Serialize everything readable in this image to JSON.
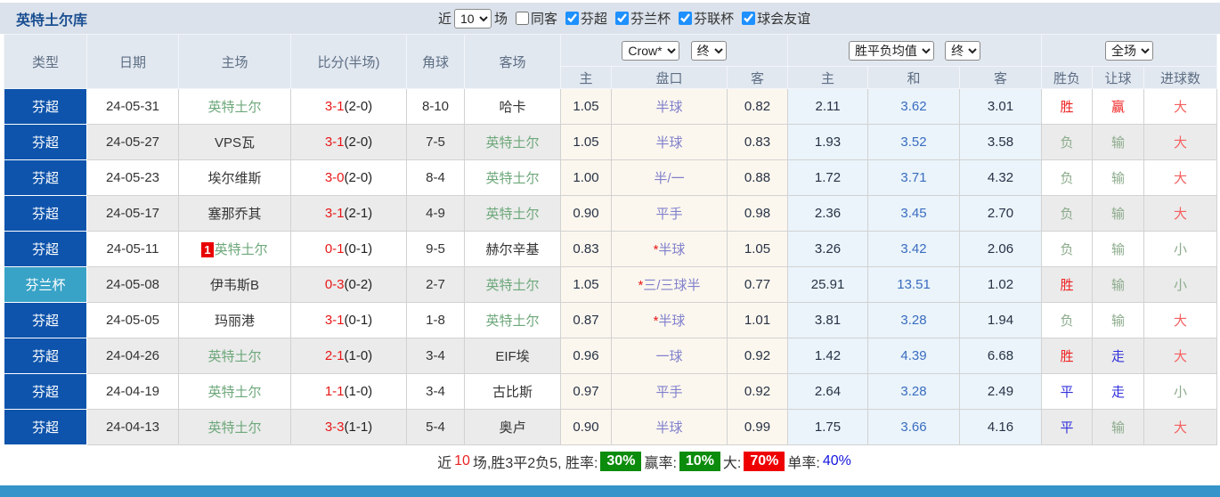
{
  "topbar": {
    "title": "英特土尔库",
    "recent_label": "近",
    "recent_value": "10",
    "matches_label": "场",
    "same_venue": {
      "label": "同客",
      "checked": false
    },
    "filters": [
      {
        "label": "芬超",
        "checked": true
      },
      {
        "label": "芬兰杯",
        "checked": true
      },
      {
        "label": "芬联杯",
        "checked": true
      },
      {
        "label": "球会友谊",
        "checked": true
      }
    ]
  },
  "table_header": {
    "cols": [
      "类型",
      "日期",
      "主场",
      "比分(半场)",
      "角球",
      "客场"
    ],
    "bookmaker": "Crow*",
    "odds_time": "终",
    "avg_name": "胜平负均值",
    "avg_time": "终",
    "scope": "全场",
    "sub": [
      "主",
      "盘口",
      "客",
      "主",
      "和",
      "客",
      "胜负",
      "让球",
      "进球数"
    ]
  },
  "rows": [
    {
      "league": "芬超",
      "lcls": "lg-super",
      "date": "24-05-31",
      "badge": "",
      "home": "英特土尔",
      "hcls": "self",
      "score": "3-1",
      "half": "(2-0)",
      "corner": "8-10",
      "away": "哈卡",
      "acls": "",
      "odds_home": "1.05",
      "star": "",
      "handicap": "半球",
      "odds_away": "0.82",
      "avg_home": "2.11",
      "avg_draw": "3.62",
      "avg_away": "3.01",
      "result": "胜",
      "result_cls": "c-red",
      "hr": "赢",
      "hr_cls": "c-red",
      "goals": "大",
      "goals_cls": "c-red2"
    },
    {
      "league": "芬超",
      "lcls": "lg-super",
      "date": "24-05-27",
      "badge": "",
      "home": "VPS瓦",
      "hcls": "",
      "score": "3-1",
      "half": "(2-0)",
      "corner": "7-5",
      "away": "英特土尔",
      "acls": "self",
      "odds_home": "1.05",
      "star": "",
      "handicap": "半球",
      "odds_away": "0.83",
      "avg_home": "1.93",
      "avg_draw": "3.52",
      "avg_away": "3.58",
      "result": "负",
      "result_cls": "c-green",
      "hr": "输",
      "hr_cls": "c-green",
      "goals": "大",
      "goals_cls": "c-red2"
    },
    {
      "league": "芬超",
      "lcls": "lg-super",
      "date": "24-05-23",
      "badge": "",
      "home": "埃尔维斯",
      "hcls": "",
      "score": "3-0",
      "half": "(2-0)",
      "corner": "8-4",
      "away": "英特土尔",
      "acls": "self",
      "odds_home": "1.00",
      "star": "",
      "handicap": "半/一",
      "odds_away": "0.88",
      "avg_home": "1.72",
      "avg_draw": "3.71",
      "avg_away": "4.32",
      "result": "负",
      "result_cls": "c-green",
      "hr": "输",
      "hr_cls": "c-green",
      "goals": "大",
      "goals_cls": "c-red2"
    },
    {
      "league": "芬超",
      "lcls": "lg-super",
      "date": "24-05-17",
      "badge": "",
      "home": "塞那乔其",
      "hcls": "",
      "score": "3-1",
      "half": "(2-1)",
      "corner": "4-9",
      "away": "英特土尔",
      "acls": "self",
      "odds_home": "0.90",
      "star": "",
      "handicap": "平手",
      "odds_away": "0.98",
      "avg_home": "2.36",
      "avg_draw": "3.45",
      "avg_away": "2.70",
      "result": "负",
      "result_cls": "c-green",
      "hr": "输",
      "hr_cls": "c-green",
      "goals": "大",
      "goals_cls": "c-red2"
    },
    {
      "league": "芬超",
      "lcls": "lg-super",
      "date": "24-05-11",
      "badge": "1",
      "home": "英特土尔",
      "hcls": "self",
      "score": "0-1",
      "half": "(0-1)",
      "corner": "9-5",
      "away": "赫尔辛基",
      "acls": "",
      "odds_home": "0.83",
      "star": "*",
      "handicap": "半球",
      "odds_away": "1.05",
      "avg_home": "3.26",
      "avg_draw": "3.42",
      "avg_away": "2.06",
      "result": "负",
      "result_cls": "c-green",
      "hr": "输",
      "hr_cls": "c-green",
      "goals": "小",
      "goals_cls": "c-green"
    },
    {
      "league": "芬兰杯",
      "lcls": "lg-cup",
      "date": "24-05-08",
      "badge": "",
      "home": "伊韦斯B",
      "hcls": "",
      "score": "0-3",
      "half": "(0-2)",
      "corner": "2-7",
      "away": "英特土尔",
      "acls": "self",
      "odds_home": "1.05",
      "star": "*",
      "handicap": "三/三球半",
      "odds_away": "0.77",
      "avg_home": "25.91",
      "avg_draw": "13.51",
      "avg_away": "1.02",
      "result": "胜",
      "result_cls": "c-red",
      "hr": "输",
      "hr_cls": "c-green",
      "goals": "小",
      "goals_cls": "c-green"
    },
    {
      "league": "芬超",
      "lcls": "lg-super",
      "date": "24-05-05",
      "badge": "",
      "home": "玛丽港",
      "hcls": "",
      "score": "3-1",
      "half": "(0-1)",
      "corner": "1-8",
      "away": "英特土尔",
      "acls": "self",
      "odds_home": "0.87",
      "star": "*",
      "handicap": "半球",
      "odds_away": "1.01",
      "avg_home": "3.81",
      "avg_draw": "3.28",
      "avg_away": "1.94",
      "result": "负",
      "result_cls": "c-green",
      "hr": "输",
      "hr_cls": "c-green",
      "goals": "大",
      "goals_cls": "c-red2"
    },
    {
      "league": "芬超",
      "lcls": "lg-super",
      "date": "24-04-26",
      "badge": "",
      "home": "英特土尔",
      "hcls": "self",
      "score": "2-1",
      "half": "(1-0)",
      "corner": "3-4",
      "away": "EIF埃",
      "acls": "",
      "odds_home": "0.96",
      "star": "",
      "handicap": "一球",
      "odds_away": "0.92",
      "avg_home": "1.42",
      "avg_draw": "4.39",
      "avg_away": "6.68",
      "result": "胜",
      "result_cls": "c-red",
      "hr": "走",
      "hr_cls": "c-blue",
      "goals": "大",
      "goals_cls": "c-red2"
    },
    {
      "league": "芬超",
      "lcls": "lg-super",
      "date": "24-04-19",
      "badge": "",
      "home": "英特土尔",
      "hcls": "self",
      "score": "1-1",
      "half": "(1-0)",
      "corner": "3-4",
      "away": "古比斯",
      "acls": "",
      "odds_home": "0.97",
      "star": "",
      "handicap": "平手",
      "odds_away": "0.92",
      "avg_home": "2.64",
      "avg_draw": "3.28",
      "avg_away": "2.49",
      "result": "平",
      "result_cls": "c-blue",
      "hr": "走",
      "hr_cls": "c-blue",
      "goals": "小",
      "goals_cls": "c-green"
    },
    {
      "league": "芬超",
      "lcls": "lg-super",
      "date": "24-04-13",
      "badge": "",
      "home": "英特土尔",
      "hcls": "self",
      "score": "3-3",
      "half": "(1-1)",
      "corner": "5-4",
      "away": "奥卢",
      "acls": "",
      "odds_home": "0.90",
      "star": "",
      "handicap": "半球",
      "odds_away": "0.99",
      "avg_home": "1.75",
      "avg_draw": "3.66",
      "avg_away": "4.16",
      "result": "平",
      "result_cls": "c-blue",
      "hr": "输",
      "hr_cls": "c-green",
      "goals": "大",
      "goals_cls": "c-red2"
    }
  ],
  "summary": {
    "prefix": "近",
    "count": "10",
    "record": "场,胜3平2负5, 胜率:",
    "win_rate": "30%",
    "handicap_label": "赢率:",
    "handicap_rate": "10%",
    "big_label": "大:",
    "big_rate": "70%",
    "single_label": "单率:",
    "single_rate": "40%"
  },
  "colors": {
    "league_blue": "#0e54ac",
    "cup_teal": "#39a3c7",
    "footer_blue": "#3594c9",
    "badge_green": "#0c8c0c",
    "badge_red": "#ee0000"
  }
}
